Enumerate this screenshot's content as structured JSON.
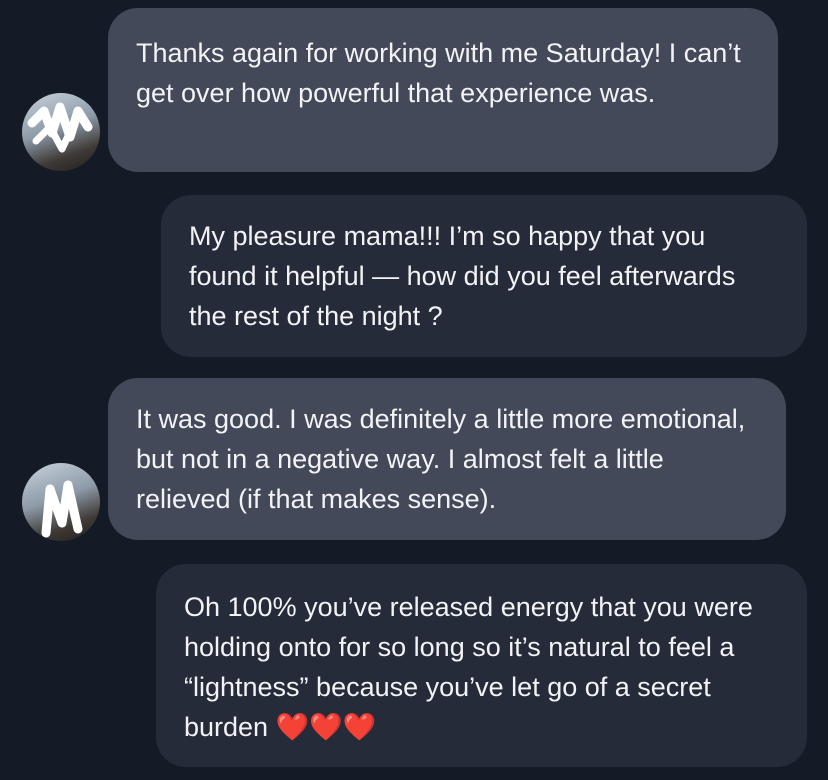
{
  "colors": {
    "background": "#141a26",
    "incoming_bubble": "#434958",
    "outgoing_bubble": "#252b38",
    "text": "#f2f3f6",
    "heart": "#e0262f"
  },
  "messages": [
    {
      "direction": "incoming",
      "text": "Thanks again for working with me Saturday! I can’t get over how powerful that experience was."
    },
    {
      "direction": "outgoing",
      "text": "My pleasure mama!!! I’m so happy that you found it helpful — how did you feel afterwards the rest of the night ?"
    },
    {
      "direction": "incoming",
      "text": "It was good. I was definitely a little more emotional, but not in a negative way. I almost felt a little relieved (if that makes sense)."
    },
    {
      "direction": "outgoing",
      "text": "Oh 100% you’ve released energy that you were holding onto for so long so it’s natural to feel a “lightness” because you’ve let go of a secret burden",
      "emoji": "❤️❤️❤️"
    }
  ]
}
